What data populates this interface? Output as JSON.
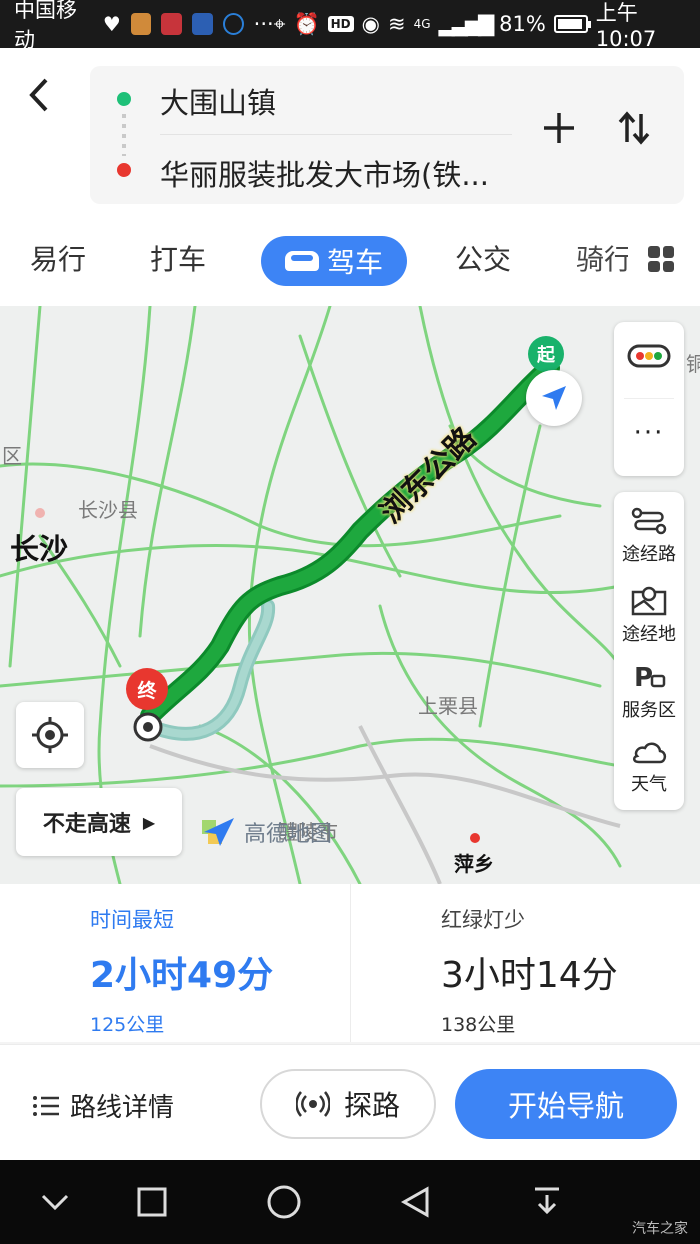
{
  "status_bar": {
    "carrier": "中国移动",
    "dots": "···",
    "network": "4G",
    "battery": "81%",
    "battery_level": 0.81,
    "time": "上午10:07"
  },
  "route": {
    "origin": "大围山镇",
    "destination": "华丽服装批发大市场(铁..."
  },
  "tabs": [
    {
      "label": "易行"
    },
    {
      "label": "打车"
    },
    {
      "label": "驾车",
      "active": true
    },
    {
      "label": "公交"
    },
    {
      "label": "骑行"
    }
  ],
  "map": {
    "road_label": "浏东公路",
    "labels": {
      "qu": "区",
      "changshaxian": "长沙县",
      "changsha": "长沙",
      "shangli": "上栗县",
      "liling": "醴陵市",
      "pingxiang": "萍乡",
      "edge": "铜"
    },
    "start_pin": "起",
    "end_pin": "终",
    "tools": {
      "waypoint": "途经路",
      "via_place": "途经地",
      "service_area": "服务区",
      "weather": "天气",
      "more": "···"
    },
    "avoid_highway": "不走高速",
    "brand": "高德地图"
  },
  "routes": [
    {
      "label": "时间最短",
      "time": "2小时49分",
      "distance": "125公里",
      "selected": true
    },
    {
      "label": "红绿灯少",
      "time": "3小时14分",
      "distance": "138公里",
      "selected": false
    }
  ],
  "actions": {
    "details": "路线详情",
    "probe": "探路",
    "start": "开始导航"
  },
  "watermark": "汽车之家",
  "colors": {
    "accent": "#3d84f5",
    "route_green": "#1ea83e",
    "start_green": "#19b26b",
    "end_red": "#e8372f"
  }
}
